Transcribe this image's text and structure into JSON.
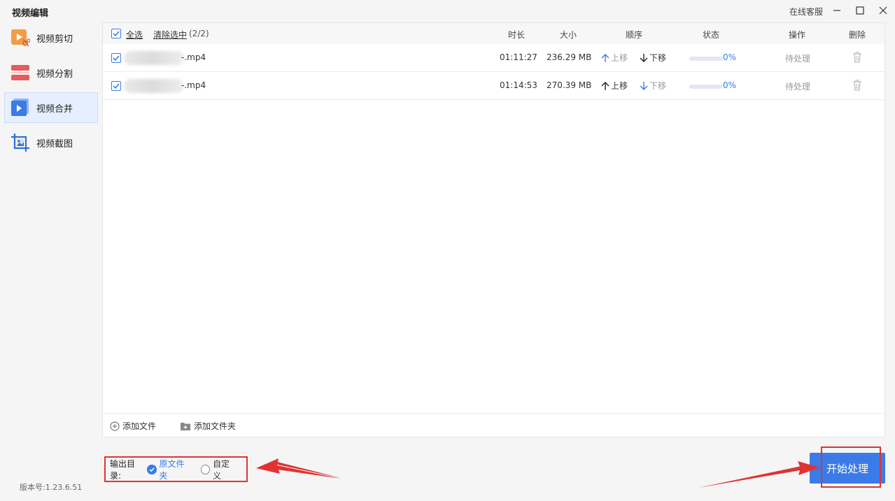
{
  "app": {
    "title": "视频编辑",
    "support": "在线客服"
  },
  "sidebar": {
    "items": [
      {
        "label": "视频剪切",
        "icon": "video-cut-icon"
      },
      {
        "label": "视频分割",
        "icon": "video-split-icon"
      },
      {
        "label": "视频合并",
        "icon": "video-merge-icon",
        "active": true
      },
      {
        "label": "视频截图",
        "icon": "video-screenshot-icon"
      }
    ],
    "version": "版本号:1.23.6.51"
  },
  "table": {
    "select_all": "全选",
    "clear_selection": "清除选中",
    "selection_count": "(2/2)",
    "headers": {
      "duration": "时长",
      "size": "大小",
      "order": "顺序",
      "status": "状态",
      "operation": "操作",
      "delete": "删除"
    },
    "rows": [
      {
        "filename_suffix": "-.mp4",
        "duration": "01:11:27",
        "size": "236.29 MB",
        "move_up": "上移",
        "move_down": "下移",
        "progress_pct": 0,
        "progress_text": "0%",
        "operation": "待处理"
      },
      {
        "filename_suffix": "-.mp4",
        "duration": "01:14:53",
        "size": "270.39 MB",
        "move_up": "上移",
        "move_down": "下移",
        "progress_pct": 0,
        "progress_text": "0%",
        "operation": "待处理"
      }
    ]
  },
  "footer": {
    "add_file": "添加文件",
    "add_folder": "添加文件夹"
  },
  "output": {
    "label": "输出目录:",
    "option_original": "原文件夹",
    "option_custom": "自定义",
    "selected": "原文件夹"
  },
  "actions": {
    "start": "开始处理"
  },
  "colors": {
    "accent": "#3b7be8",
    "highlight": "#e03333"
  }
}
